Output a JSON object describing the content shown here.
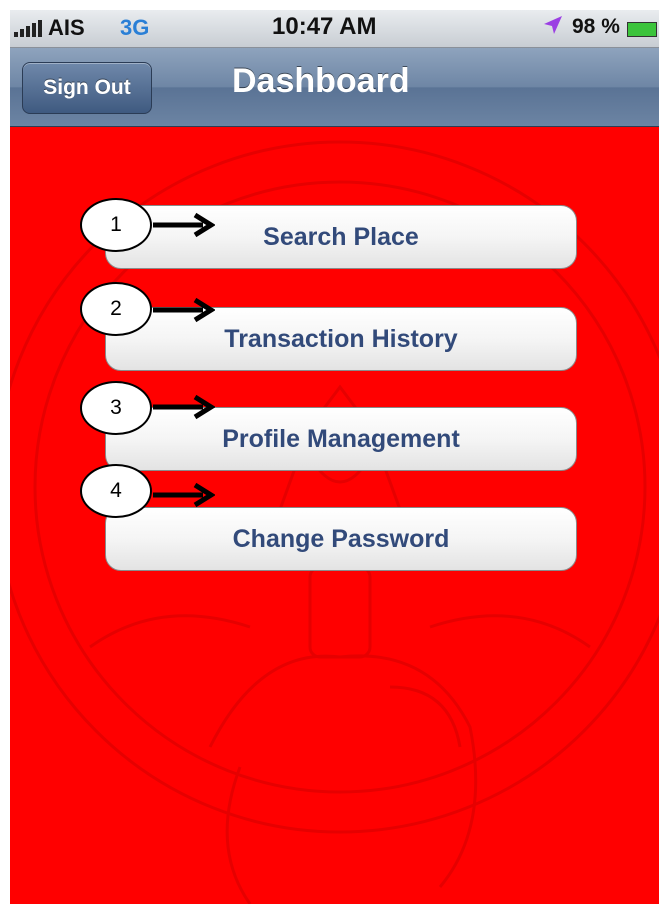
{
  "status_bar": {
    "carrier": "AIS",
    "network": "3G",
    "time": "10:47 AM",
    "battery_percent": "98 %",
    "icons": [
      "signal-bars-icon",
      "location-arrow-icon",
      "battery-icon"
    ]
  },
  "nav_bar": {
    "sign_out_label": "Sign Out",
    "title": "Dashboard"
  },
  "menu": {
    "items": [
      {
        "callout": "1",
        "label": "Search Place"
      },
      {
        "callout": "2",
        "label": "Transaction History"
      },
      {
        "callout": "3",
        "label": "Profile Management"
      },
      {
        "callout": "4",
        "label": "Change Password"
      }
    ]
  },
  "colors": {
    "background": "#ff0000",
    "nav_bar": "#6e86a5",
    "button_text": "#324a7a",
    "network_text": "#2a7fd6",
    "location_icon": "#9b3fe3",
    "battery_fill": "#3cc43c"
  }
}
